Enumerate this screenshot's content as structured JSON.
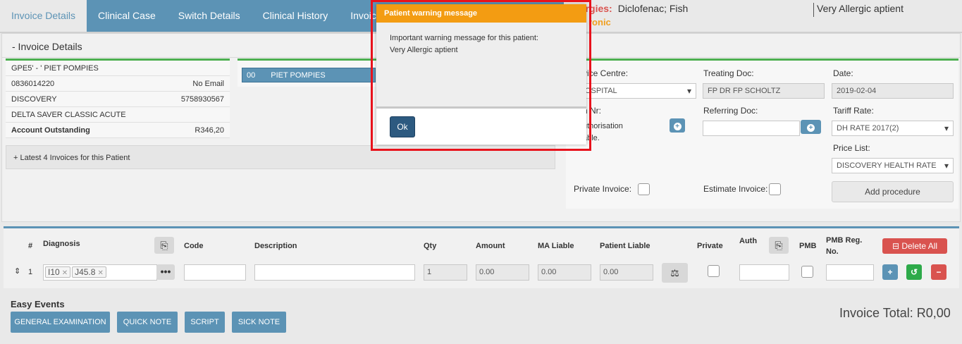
{
  "tabs": [
    {
      "label": "Invoice Details"
    },
    {
      "label": "Clinical Case"
    },
    {
      "label": "Switch Details"
    },
    {
      "label": "Clinical History"
    },
    {
      "label": "Invoice N"
    }
  ],
  "allergies": {
    "label": "llergies:",
    "value": "Diclofenac; Fish",
    "chronic": "ronic",
    "note": "Very Allergic aptient"
  },
  "invoice_section": {
    "header": "- Invoice Details"
  },
  "patient": {
    "account": "GPE5' - ' PIET POMPIES",
    "phone": "0836014220",
    "email": "No Email",
    "medical_aid": "DISCOVERY",
    "member_no": "5758930567",
    "plan": "DELTA SAVER CLASSIC ACUTE",
    "outstanding_label": "Account Outstanding",
    "outstanding_value": "R346,20"
  },
  "latest_invoices": "+ Latest 4 Invoices for this Patient",
  "member": {
    "code": "00",
    "name": "PIET POMPIES"
  },
  "form": {
    "service_centre_label": "vice Centre:",
    "service_centre_value": "OSPITAL",
    "treating_doc_label": "Treating Doc:",
    "treating_doc_value": "FP DR FP SCHOLTZ",
    "date_label": "Date:",
    "date_value": "2019-02-04",
    "auth_label": "h Nr:",
    "auth_text_1": "uthorisation",
    "auth_text_2": "able.",
    "referring_doc_label": "Referring Doc:",
    "tariff_label": "Tariff Rate:",
    "tariff_value": "DH RATE 2017(2)",
    "price_list_label": "Price List:",
    "price_list_value": "DISCOVERY HEALTH RATE",
    "private_invoice_label": "Private Invoice:",
    "estimate_invoice_label": "Estimate Invoice:",
    "add_procedure": "Add procedure"
  },
  "grid": {
    "headers": {
      "num": "#",
      "diagnosis": "Diagnosis",
      "code": "Code",
      "description": "Description",
      "qty": "Qty",
      "amount": "Amount",
      "ma_liable": "MA Liable",
      "patient_liable": "Patient Liable",
      "private": "Private",
      "auth": "Auth",
      "pmb": "PMB",
      "pmb_reg_1": "PMB Reg.",
      "pmb_reg_2": "No."
    },
    "delete_all": "Delete All",
    "row": {
      "num": "1",
      "diag_1": "I10",
      "diag_2": "J45.8",
      "qty": "1",
      "amount": "0.00",
      "ma_liable": "0.00",
      "patient_liable": "0.00"
    }
  },
  "easy_events": {
    "title": "Easy Events",
    "buttons": [
      "GENERAL EXAMINATION",
      "QUICK NOTE",
      "SCRIPT",
      "SICK NOTE"
    ]
  },
  "invoice_total": "Invoice Total: R0,00",
  "modal": {
    "title": "Patient warning message",
    "line1": "Important warning message for this patient:",
    "line2": "Very Allergic aptient",
    "ok": "Ok"
  }
}
